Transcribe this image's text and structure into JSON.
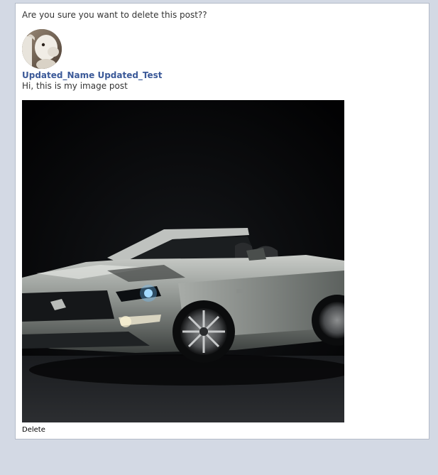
{
  "dialog": {
    "question": "Are you sure you want to delete this post??"
  },
  "post": {
    "author": "Updated_Name Updated_Test",
    "text": "Hi, this is my image post",
    "avatar_icon": "user-avatar-goat-photo",
    "image_icon": "car-photo-convertible"
  },
  "actions": {
    "delete_label": "Delete"
  },
  "colors": {
    "page_background": "#d3d9e4",
    "author_link": "#3b5998"
  }
}
